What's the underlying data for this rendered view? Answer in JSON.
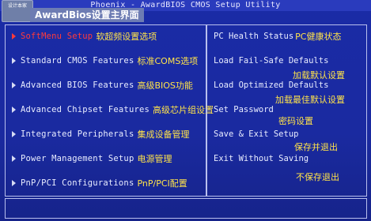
{
  "title_bar": "Phoenix - AwardBIOS CMOS Setup Utility",
  "logo_text": "设计本家",
  "main_title": "AwardBios设置主界面",
  "left_menu": [
    {
      "en": "SoftMenu Setup",
      "zh": "软超频设置选项",
      "active": true
    },
    {
      "en": "Standard CMOS Features",
      "zh": "标准COMS选项",
      "active": false
    },
    {
      "en": "Advanced BIOS Features",
      "zh": "高级BIOS功能",
      "active": false
    },
    {
      "en": "Advanced Chipset Features",
      "zh": "高级芯片组设置",
      "active": false
    },
    {
      "en": "Integrated Peripherals",
      "zh": "集成设备管理",
      "active": false
    },
    {
      "en": "Power Management Setup",
      "zh": "电源管理",
      "active": false
    },
    {
      "en": "PnP/PCI Configurations",
      "zh": "PnP/PCI配置",
      "active": false
    }
  ],
  "right_menu": [
    {
      "en": "PC Health Status",
      "zh": "PC健康状态"
    },
    {
      "en": "Load Fail-Safe Defaults",
      "zh": "加载默认设置"
    },
    {
      "en": "Load Optimized Defaults",
      "zh": "加载最佳默认设置"
    },
    {
      "en": "Set Password",
      "zh": "密码设置"
    },
    {
      "en": "Save & Exit Setup",
      "zh": "保存并退出"
    },
    {
      "en": "Exit Without Saving",
      "zh": "不保存退出"
    }
  ]
}
